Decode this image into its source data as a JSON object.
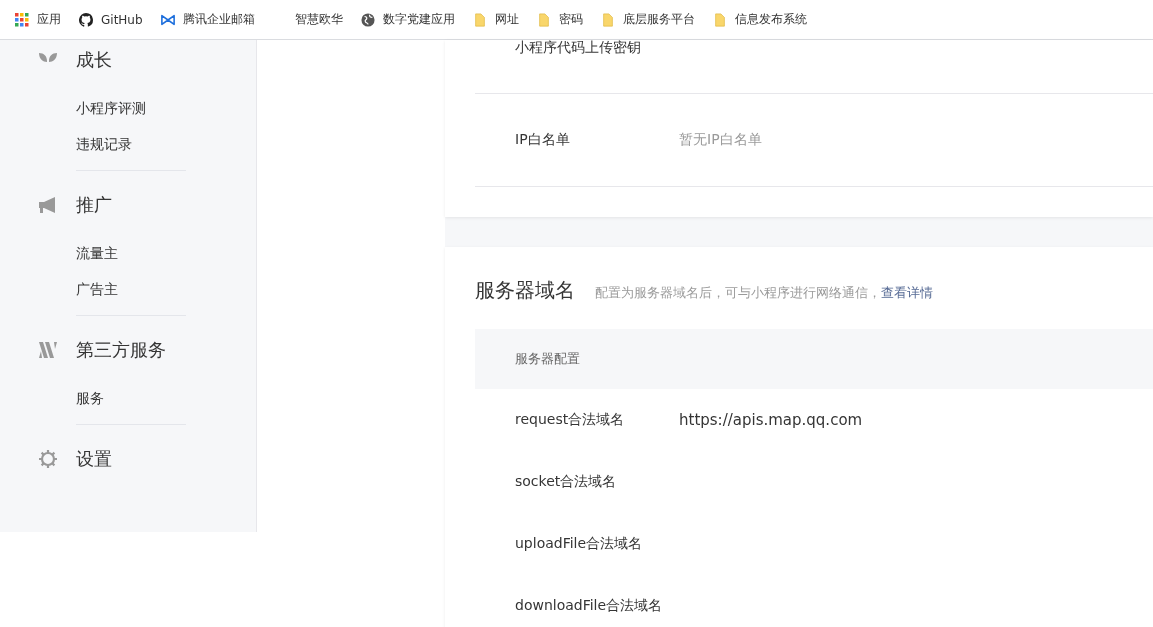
{
  "bookmarks": [
    {
      "label": "应用",
      "kind": "apps"
    },
    {
      "label": "GitHub",
      "kind": "github"
    },
    {
      "label": "腾讯企业邮箱",
      "kind": "mail"
    },
    {
      "label": "智慧欧华",
      "kind": "blank"
    },
    {
      "label": "数字党建应用",
      "kind": "globe"
    },
    {
      "label": "网址",
      "kind": "folder"
    },
    {
      "label": "密码",
      "kind": "folder"
    },
    {
      "label": "底层服务平台",
      "kind": "folder"
    },
    {
      "label": "信息发布系统",
      "kind": "folder"
    }
  ],
  "sidebar": {
    "groups": [
      {
        "title": "成长",
        "kind": "sprout",
        "items": [
          "小程序评测",
          "违规记录"
        ]
      },
      {
        "title": "推广",
        "kind": "megaphone",
        "items": [
          "流量主",
          "广告主"
        ]
      },
      {
        "title": "第三方服务",
        "kind": "service",
        "items": [
          "服务"
        ]
      },
      {
        "title": "设置",
        "kind": "gear"
      }
    ]
  },
  "dev_settings": {
    "rows": [
      {
        "label": "小程序代码上传密钥"
      },
      {
        "label": "IP白名单",
        "value": "暂无IP白名单"
      }
    ]
  },
  "server_domain": {
    "title": "服务器域名",
    "description": "配置为服务器域名后，可与小程序进行网络通信，",
    "link": "查看详情",
    "header": "服务器配置",
    "rows": [
      {
        "label": "request合法域名",
        "value": "https://apis.map.qq.com"
      },
      {
        "label": "socket合法域名"
      },
      {
        "label": "uploadFile合法域名"
      },
      {
        "label": "downloadFile合法域名"
      }
    ]
  }
}
